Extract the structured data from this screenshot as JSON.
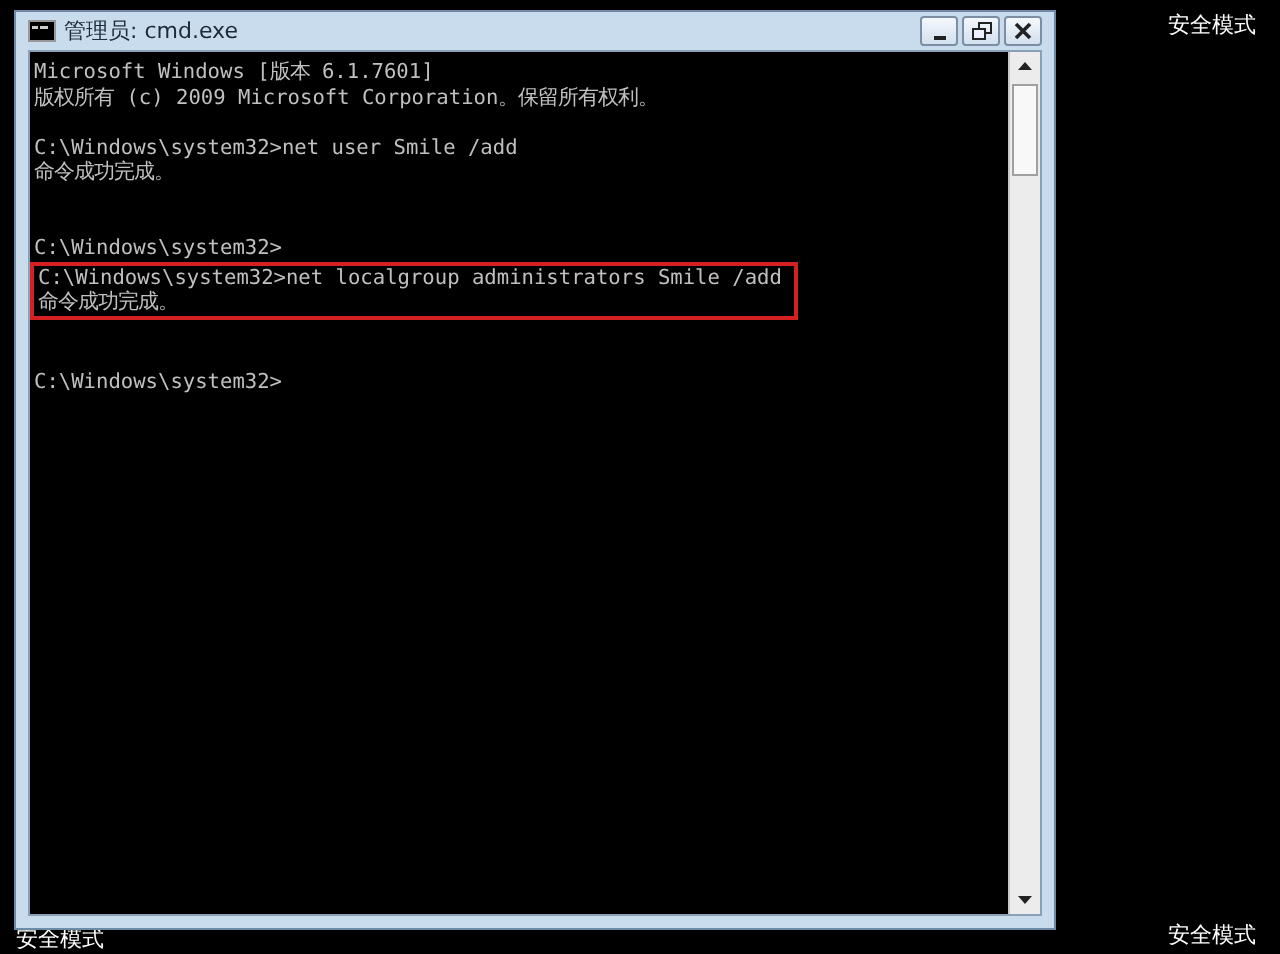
{
  "desktop": {
    "top_right_label": "安全模式",
    "bottom_left_label": "安全模式",
    "bottom_right_label": "安全模式"
  },
  "window": {
    "title": "管理员: cmd.exe"
  },
  "console": {
    "blocks": [
      {
        "highlighted": false,
        "lines": [
          {
            "kind": "text",
            "text": "Microsoft Windows [版本 6.1.7601]"
          },
          {
            "kind": "text",
            "text": "版权所有 (c) 2009 Microsoft Corporation。保留所有权利。"
          },
          {
            "kind": "blank"
          },
          {
            "kind": "text",
            "text": "C:\\Windows\\system32>net user Smile /add"
          },
          {
            "kind": "text",
            "text": "命令成功完成。"
          },
          {
            "kind": "blank"
          },
          {
            "kind": "blank"
          },
          {
            "kind": "text",
            "text": "C:\\Windows\\system32>"
          }
        ]
      },
      {
        "highlighted": true,
        "lines": [
          {
            "kind": "text",
            "text": "C:\\Windows\\system32>net localgroup administrators Smile /add"
          },
          {
            "kind": "text",
            "text": "命令成功完成。"
          }
        ]
      },
      {
        "highlighted": false,
        "lines": [
          {
            "kind": "blank"
          },
          {
            "kind": "blank"
          },
          {
            "kind": "text",
            "text": "C:\\Windows\\system32>"
          }
        ]
      }
    ]
  }
}
